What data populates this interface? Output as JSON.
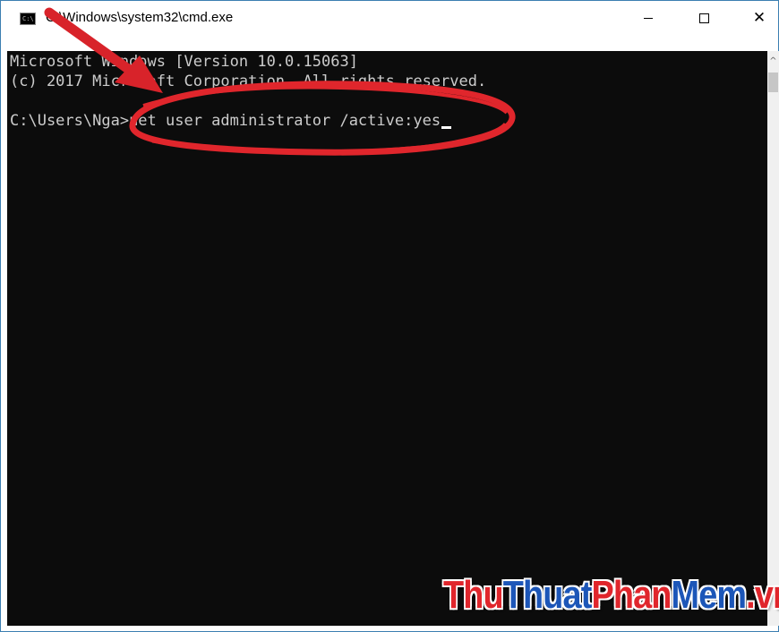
{
  "window": {
    "title": "C:\\Windows\\system32\\cmd.exe",
    "icon_text": "C:\\"
  },
  "controls": {
    "minimize": "minimize-icon",
    "maximize": "maximize-icon",
    "close_glyph": "✕"
  },
  "console": {
    "lines": [
      "Microsoft Windows [Version 10.0.15063]",
      "(c) 2017 Microsoft Corporation. All rights reserved.",
      ""
    ],
    "prompt": "C:\\Users\\Nga>",
    "command": "net user administrator /active:yes"
  },
  "scrollbar": {
    "up_glyph": "^"
  },
  "watermark": {
    "thu1": "Thu",
    "thuat": "Thuat",
    "phan": "Phan",
    "mem": "Mem",
    "vn": ".vn"
  },
  "colors": {
    "console_bg": "#0c0c0c",
    "console_text": "#cccccc",
    "annotation_red": "#e0262c",
    "watermark_blue": "#1c56b8"
  }
}
